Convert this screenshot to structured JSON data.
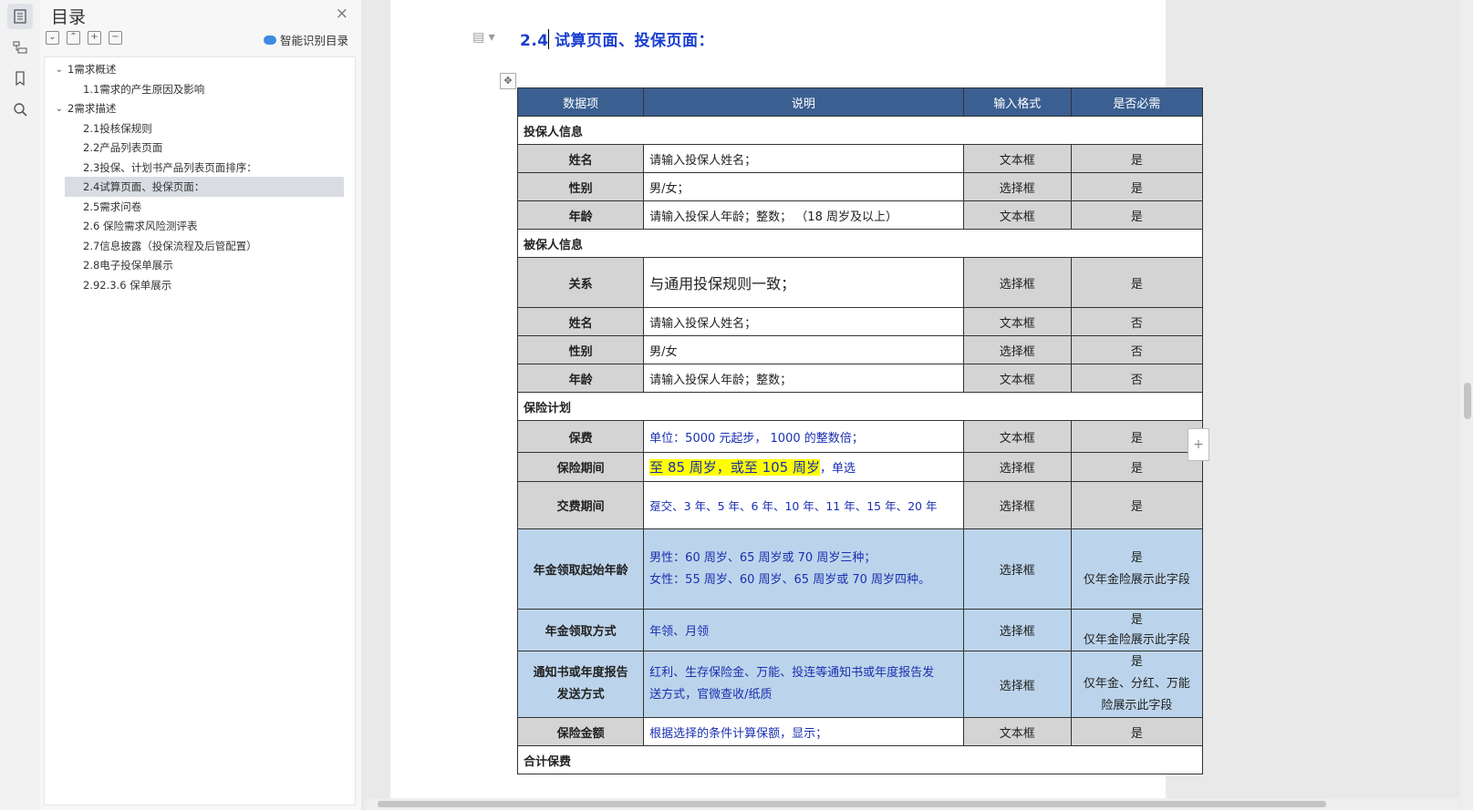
{
  "toolstrip": {
    "icons": [
      "toc-icon",
      "structure-icon",
      "bookmark-icon",
      "search-icon"
    ]
  },
  "toc": {
    "title": "目录",
    "close": "×",
    "smart_label": "智能识别目录",
    "items": [
      {
        "label": "1需求概述"
      },
      {
        "label": "1.1需求的产生原因及影响"
      },
      {
        "label": "2需求描述"
      },
      {
        "label": "2.1投核保规则"
      },
      {
        "label": "2.2产品列表页面"
      },
      {
        "label": "2.3投保、计划书产品列表页面排序："
      },
      {
        "label": "2.4试算页面、投保页面："
      },
      {
        "label": "2.5需求问卷"
      },
      {
        "label": "2.6  保险需求风险测评表"
      },
      {
        "label": "2.7信息披露（投保流程及后管配置）"
      },
      {
        "label": "2.8电子投保单展示"
      },
      {
        "label": "2.92.3.6 保单展示"
      }
    ]
  },
  "doc": {
    "heading": "2.4 试算页面、投保页面：",
    "add_col": "+",
    "table": {
      "headers": [
        "数据项",
        "说明",
        "输入格式",
        "是否必需"
      ],
      "sections": {
        "s1": "投保人信息",
        "s2": "被保人信息",
        "s3": "保险计划",
        "s4": "合计保费"
      },
      "rows": [
        {
          "item": "姓名",
          "desc": "请输入投保人姓名；",
          "format": "文本框",
          "req": "是"
        },
        {
          "item": "性别",
          "desc": "男/女；",
          "format": "选择框",
          "req": "是"
        },
        {
          "item": "年龄",
          "desc": "请输入投保人年龄；整数；  （18 周岁及以上）",
          "format": "文本框",
          "req": "是"
        },
        {
          "item": "关系",
          "desc": "与通用投保规则一致；",
          "format": "选择框",
          "req": "是"
        },
        {
          "item": "姓名",
          "desc": "请输入投保人姓名；",
          "format": "文本框",
          "req": "否"
        },
        {
          "item": "性别",
          "desc": "男/女",
          "format": "选择框",
          "req": "否"
        },
        {
          "item": "年龄",
          "desc": "请输入投保人年龄；整数；",
          "format": "文本框",
          "req": "否"
        },
        {
          "item": "保费",
          "desc": "单位：5000 元起步， 1000 的整数倍；",
          "format": "文本框",
          "req": "是"
        },
        {
          "item": "保险期间",
          "desc_hl": "至 85 周岁，或至 105 周岁",
          "desc_tail": "，单选",
          "format": "选择框",
          "req": "是"
        },
        {
          "item": "交费期间",
          "desc": "趸交、3 年、5 年、6 年、10 年、11 年、15 年、20 年",
          "format": "选择框",
          "req": "是"
        },
        {
          "item": "年金领取起始年龄",
          "desc": "男性：60 周岁、65 周岁或 70 周岁三种；",
          "desc2": "女性：55 周岁、60 周岁、65 周岁或 70 周岁四种。",
          "format": "选择框",
          "req": "是",
          "req2": "仅年金险展示此字段"
        },
        {
          "item": "年金领取方式",
          "desc": "年领、月领",
          "format": "选择框",
          "req": "是",
          "req2": "仅年金险展示此字段"
        },
        {
          "item": "通知书或年度报告",
          "item2": "发送方式",
          "desc": "红利、生存保险金、万能、投连等通知书或年度报告发",
          "desc2": "送方式，官微查收/纸质",
          "format": "选择框",
          "req": "是",
          "req2": "仅年金、分红、万能",
          "req3": "险展示此字段"
        },
        {
          "item": "保险金额",
          "desc": "根据选择的条件计算保额，显示；",
          "format": "文本框",
          "req": "是"
        }
      ]
    }
  }
}
